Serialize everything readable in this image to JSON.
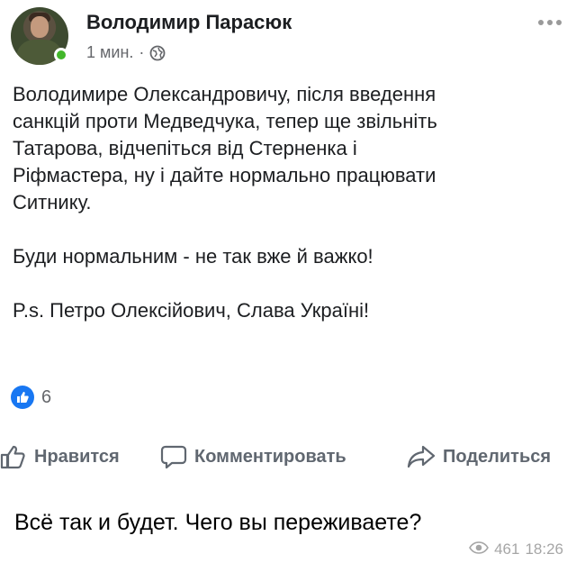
{
  "post": {
    "author": "Володимир Парасюк",
    "time": "1 мин.",
    "separator": "·",
    "privacy_icon": "globe-icon",
    "paragraph_1": "Володимире Олександровичу, після введення\nсанкцій проти Медведчука,  тепер ще звільніть\nТатарова, відчепіться від Стерненка і\nРіфмастера, ну і дайте нормально працювати\nСитнику.",
    "paragraph_2": "Буди нормальним - не так вже й важко!",
    "paragraph_3": "P.s. Петро Олексійович, Слава Україні!",
    "reaction_count": "6",
    "actions": {
      "like": "Нравится",
      "comment": "Комментировать",
      "share": "Поделиться"
    }
  },
  "message": {
    "text": "Всё так и будет. Чего вы переживаете?",
    "views": "461",
    "time": "18:26"
  },
  "colors": {
    "facebook_blue": "#1877f2",
    "online_green": "#42b72a",
    "secondary_text": "#65676b"
  }
}
